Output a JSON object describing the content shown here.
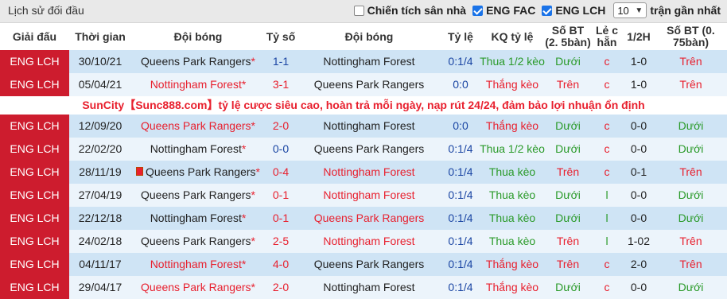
{
  "header": {
    "title": "Lịch sử đối đầu",
    "opt_home": "Chiến tích sân nhà",
    "opt_fac": "ENG FAC",
    "opt_lch": "ENG LCH",
    "count_value": "10",
    "count_suffix": "trận gần nhất"
  },
  "columns": {
    "league": "Giải đấu",
    "time": "Thời gian",
    "home": "Đội bóng",
    "score": "Tỷ số",
    "away": "Đội bóng",
    "odds": "Tỷ lệ",
    "odds_result": "KQ tỷ lệ",
    "bt25": "Số BT (2. 5bàn)",
    "oddeven": "Lẻ c hẵn",
    "half": "1/2H",
    "bt075": "Số BT (0. 75bàn)"
  },
  "ad_text": "SunCity【Sunc888.com】tỷ lệ cược siêu cao, hoàn trả mỗi ngày, nạp rút 24/24, đảm bảo lợi nhuận ổn định",
  "rows": [
    {
      "league": "ENG LCH",
      "date": "30/10/21",
      "home": "Queens Park Rangers",
      "home_star": "*",
      "score": "1-1",
      "away": "Nottingham Forest",
      "odds": "0:1/4",
      "kq": "Thua 1/2 kèo",
      "bt": "Dưới",
      "lc": "c",
      "half": "1-0",
      "bt2": "Trên"
    },
    {
      "league": "ENG LCH",
      "date": "05/04/21",
      "home": "Nottingham Forest",
      "home_star": "*",
      "score": "3-1",
      "away": "Queens Park Rangers",
      "odds": "0:0",
      "kq": "Thắng kèo",
      "bt": "Trên",
      "lc": "c",
      "half": "1-0",
      "bt2": "Trên"
    },
    {
      "league": "ENG LCH",
      "date": "12/09/20",
      "home": "Queens Park Rangers",
      "home_star": "*",
      "score": "2-0",
      "away": "Nottingham Forest",
      "odds": "0:0",
      "kq": "Thắng kèo",
      "bt": "Dưới",
      "lc": "c",
      "half": "0-0",
      "bt2": "Dưới"
    },
    {
      "league": "ENG LCH",
      "date": "22/02/20",
      "home": "Nottingham Forest",
      "home_star": "*",
      "score": "0-0",
      "away": "Queens Park Rangers",
      "odds": "0:1/4",
      "kq": "Thua 1/2 kèo",
      "bt": "Dưới",
      "lc": "c",
      "half": "0-0",
      "bt2": "Dưới"
    },
    {
      "league": "ENG LCH",
      "date": "28/11/19",
      "home": "Queens Park Rangers",
      "home_star": "*",
      "score": "0-4",
      "away": "Nottingham Forest",
      "odds": "0:1/4",
      "kq": "Thua kèo",
      "bt": "Trên",
      "lc": "c",
      "half": "0-1",
      "bt2": "Trên"
    },
    {
      "league": "ENG LCH",
      "date": "27/04/19",
      "home": "Queens Park Rangers",
      "home_star": "*",
      "score": "0-1",
      "away": "Nottingham Forest",
      "odds": "0:1/4",
      "kq": "Thua kèo",
      "bt": "Dưới",
      "lc": "l",
      "half": "0-0",
      "bt2": "Dưới"
    },
    {
      "league": "ENG LCH",
      "date": "22/12/18",
      "home": "Nottingham Forest",
      "home_star": "*",
      "score": "0-1",
      "away": "Queens Park Rangers",
      "odds": "0:1/4",
      "kq": "Thua kèo",
      "bt": "Dưới",
      "lc": "l",
      "half": "0-0",
      "bt2": "Dưới"
    },
    {
      "league": "ENG LCH",
      "date": "24/02/18",
      "home": "Queens Park Rangers",
      "home_star": "*",
      "score": "2-5",
      "away": "Nottingham Forest",
      "odds": "0:1/4",
      "kq": "Thua kèo",
      "bt": "Trên",
      "lc": "l",
      "half": "1-02",
      "bt2": "Trên"
    },
    {
      "league": "ENG LCH",
      "date": "04/11/17",
      "home": "Nottingham Forest",
      "home_star": "*",
      "score": "4-0",
      "away": "Queens Park Rangers",
      "odds": "0:1/4",
      "kq": "Thắng kèo",
      "bt": "Trên",
      "lc": "c",
      "half": "2-0",
      "bt2": "Trên"
    },
    {
      "league": "ENG LCH",
      "date": "29/04/17",
      "home": "Queens Park Rangers",
      "home_star": "*",
      "score": "2-0",
      "away": "Nottingham Forest",
      "odds": "0:1/4",
      "kq": "Thắng kèo",
      "bt": "Dưới",
      "lc": "c",
      "half": "0-0",
      "bt2": "Dưới"
    }
  ],
  "colors": {
    "league_bg": "#cd1c2e",
    "row_odd": "#cfe4f5",
    "row_even": "#ecf4fb",
    "win": "#e8202e",
    "lose": "#2a9a29",
    "draw": "#1a45a3"
  }
}
